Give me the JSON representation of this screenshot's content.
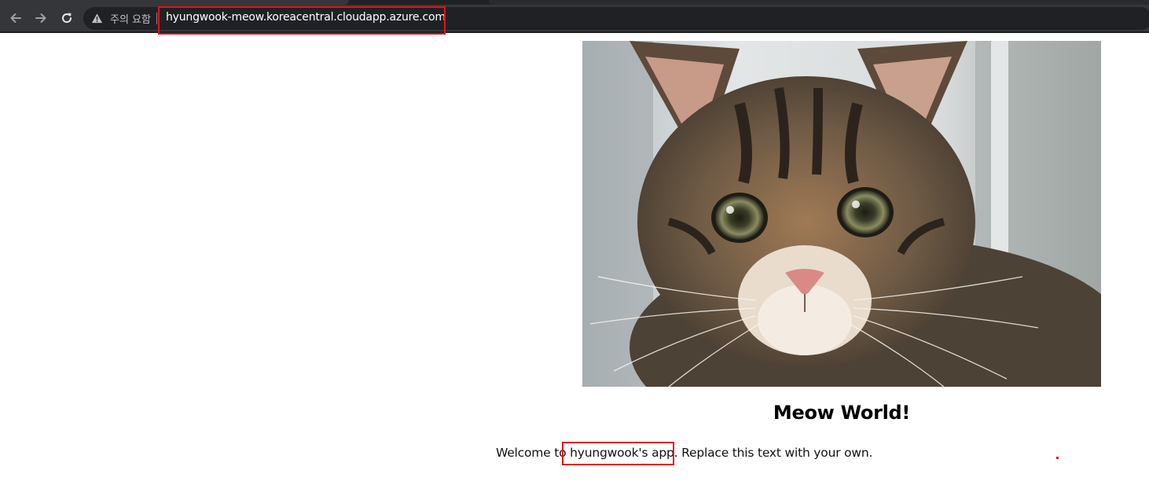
{
  "browser": {
    "security_label": "주의 요함",
    "url": "hyungwook-meow.koreacentral.cloudapp.azure.com",
    "icons": {
      "back": "back-arrow-icon",
      "forward": "forward-arrow-icon",
      "reload": "reload-icon",
      "warning": "warning-triangle-icon"
    }
  },
  "page": {
    "heading": "Meow World!",
    "welcome_prefix": "Welcome to ",
    "app_name": "hyungwook's app.",
    "welcome_suffix": " Replace this text with your own."
  },
  "colors": {
    "chrome_toolbar": "#35363a",
    "omnibox": "#202124",
    "highlight_box": "#e2121d"
  }
}
